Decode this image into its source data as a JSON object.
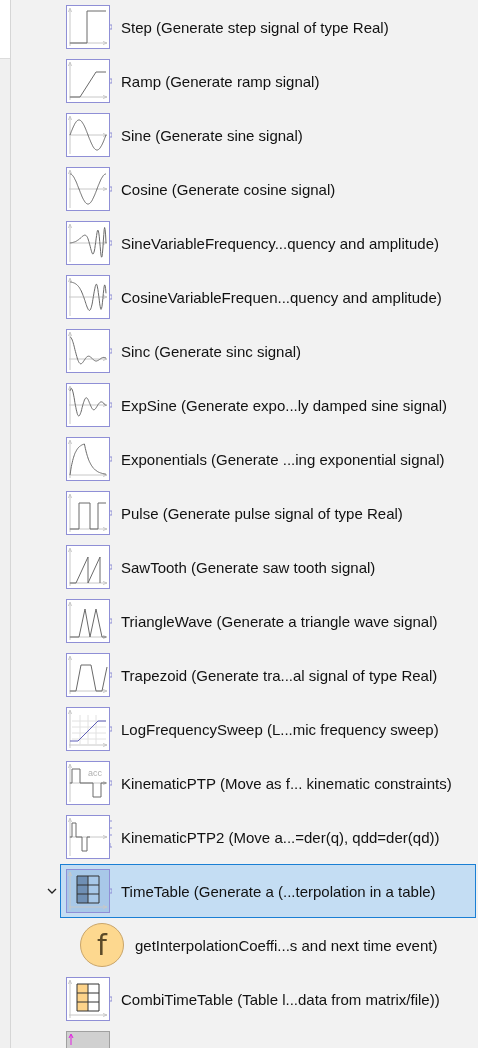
{
  "tree": {
    "items": [
      {
        "kind": "step",
        "label": "Step (Generate step signal of type Real)",
        "selected": false
      },
      {
        "kind": "ramp",
        "label": "Ramp (Generate ramp signal)",
        "selected": false
      },
      {
        "kind": "sine",
        "label": "Sine (Generate sine signal)",
        "selected": false
      },
      {
        "kind": "cosine",
        "label": "Cosine (Generate cosine signal)",
        "selected": false
      },
      {
        "kind": "sine_var",
        "label": "SineVariableFrequency...quency and amplitude)",
        "selected": false
      },
      {
        "kind": "cosine_var",
        "label": "CosineVariableFrequen...quency and amplitude)",
        "selected": false
      },
      {
        "kind": "sinc",
        "label": "Sinc (Generate sinc signal)",
        "selected": false
      },
      {
        "kind": "expsine",
        "label": "ExpSine (Generate expo...ly damped sine signal)",
        "selected": false
      },
      {
        "kind": "exponentials",
        "label": "Exponentials (Generate ...ing exponential signal)",
        "selected": false
      },
      {
        "kind": "pulse",
        "label": "Pulse (Generate pulse signal of type Real)",
        "selected": false
      },
      {
        "kind": "sawtooth",
        "label": "SawTooth (Generate saw tooth signal)",
        "selected": false
      },
      {
        "kind": "triangle",
        "label": "TriangleWave (Generate a triangle wave signal)",
        "selected": false
      },
      {
        "kind": "trapezoid",
        "label": "Trapezoid (Generate tra...al signal of type Real)",
        "selected": false
      },
      {
        "kind": "logsweep",
        "label": "LogFrequencySweep (L...mic frequency sweep)",
        "selected": false
      },
      {
        "kind": "kinematic",
        "icon_text": "acc",
        "label": "KinematicPTP (Move as f... kinematic constraints)",
        "selected": false
      },
      {
        "kind": "kinematic2",
        "label": "KinematicPTP2 (Move a...=der(q), qdd=der(qd))",
        "selected": false
      },
      {
        "kind": "timetable",
        "label": "TimeTable (Generate a (...terpolation in a table)",
        "selected": true,
        "expanded": true,
        "children": [
          {
            "kind": "function",
            "icon_text": "f",
            "label": "getInterpolationCoeffi...s and next time event)",
            "selected": false
          }
        ]
      },
      {
        "kind": "combitable",
        "label": "CombiTimeTable (Table l...data from matrix/file))",
        "selected": false
      },
      {
        "kind": "block",
        "selected": false
      }
    ]
  }
}
